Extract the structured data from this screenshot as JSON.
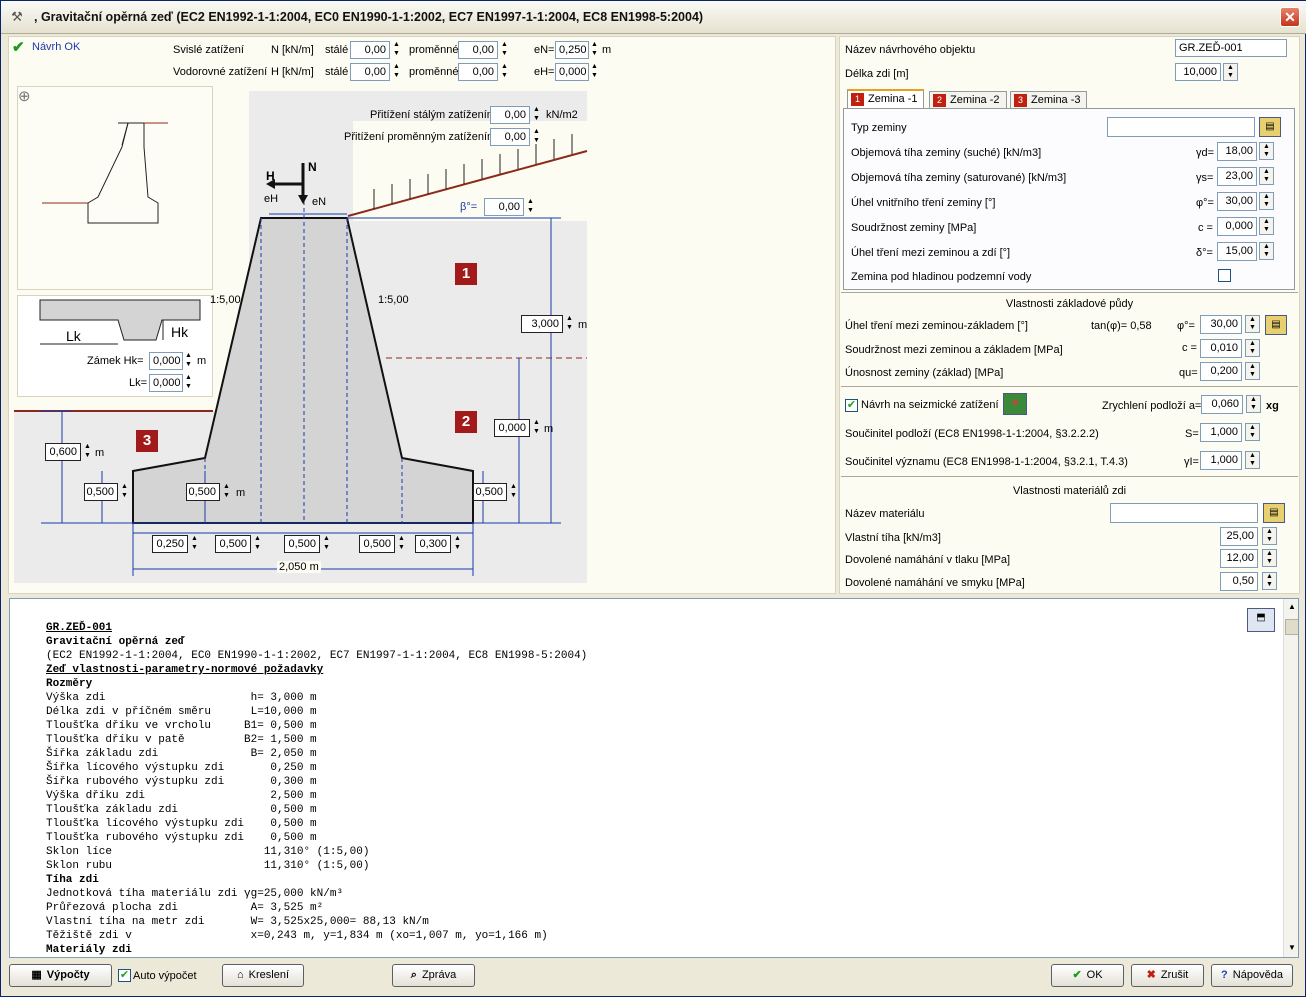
{
  "window": {
    "title": ", Gravitační opěrná zeď (EC2 EN1992-1-1:2004, EC0 EN1990-1-1:2002, EC7 EN1997-1-1:2004, EC8 EN1998-5:2004)",
    "close_label": "✕"
  },
  "status": {
    "label": "Návrh OK"
  },
  "loads": {
    "vertical_label": "Svislé zatížení",
    "vertical_unit": "N [kN/m]",
    "horizontal_label": "Vodorovné zatížení",
    "horizontal_unit": "H [kN/m]",
    "permanent_label": "stálé",
    "variable_label": "proměnné",
    "N_perm": "0,00",
    "N_var": "0,00",
    "eN_label": "eN=",
    "eN": "0,250",
    "eN_unit": "m",
    "H_perm": "0,00",
    "H_var": "0,00",
    "eH_label": "eH=",
    "eH": "0,000"
  },
  "surcharge": {
    "perm_label": "Přitížení stálým zatížením",
    "perm": "0,00",
    "perm_unit": "kN/m2",
    "var_label": "Přitížení proměnným zatížením",
    "var": "0,00"
  },
  "drawing": {
    "beta_label": "β°=",
    "beta": "0,00",
    "H": "H",
    "N": "N",
    "eH_mark": "eH",
    "eN_mark": "eN",
    "slope_left": "1:5,00",
    "slope_right": "1:5,00",
    "height": "3,000",
    "height_unit": "m",
    "water": "0,000",
    "water_unit": "m",
    "front_soil": "0,600",
    "front_soil_unit": "m",
    "toe_thk": "0,500",
    "base_thk": "0,500",
    "base_thk_unit": "m",
    "heel_thk": "0,500",
    "b1": "0,250",
    "b2": "0,500",
    "b3": "0,500",
    "b4": "0,500",
    "b5": "0,300",
    "total_width": "2,050",
    "total_unit": "m",
    "marker1": "1",
    "marker2": "2",
    "marker3": "3"
  },
  "key": {
    "lk_label": "Lk",
    "hk_label": "Hk",
    "zamek_label": "Zámek Hk=",
    "hk": "0,000",
    "hk_unit": "m",
    "lk_field_label": "Lk=",
    "lk": "0,000"
  },
  "object": {
    "name_label": "Název návrhového objektu",
    "name": "GR.ZEĎ-001",
    "length_label": "Délka zdi [m]",
    "length": "10,000"
  },
  "tabs": [
    {
      "num": "1",
      "label": "Zemina -1"
    },
    {
      "num": "2",
      "label": "Zemina -2"
    },
    {
      "num": "3",
      "label": "Zemina -3"
    }
  ],
  "soil": {
    "type_label": "Typ zeminy",
    "type": "",
    "rows": [
      {
        "label": "Objemová tíha zeminy (suché) [kN/m3]",
        "sym": "γd=",
        "value": "18,00"
      },
      {
        "label": "Objemová tíha zeminy (saturované) [kN/m3]",
        "sym": "γs=",
        "value": "23,00"
      },
      {
        "label": "Úhel vnitřního tření zeminy [°]",
        "sym": "φ°=",
        "value": "30,00"
      },
      {
        "label": "Soudržnost zeminy [MPa]",
        "sym": "c =",
        "value": "0,000"
      },
      {
        "label": "Úhel tření mezi zeminou a zdí [°]",
        "sym": "δ°=",
        "value": "15,00"
      }
    ],
    "water_label": "Zemina pod hladinou podzemní vody"
  },
  "foundation": {
    "title": "Vlastnosti základové půdy",
    "friction_label": "Úhel tření mezi zeminou-základem [°]",
    "tan_label": "tan(φ)= 0,58",
    "phi_sym": "φ°=",
    "phi": "30,00",
    "cohesion_label": "Soudržnost mezi zeminou a základem [MPa]",
    "c_sym": "c =",
    "c": "0,010",
    "bearing_label": "Únosnost zeminy (základ) [MPa]",
    "qu_sym": "qu=",
    "qu": "0,200"
  },
  "seismic": {
    "check_label": "Návrh na seizmické zatížení",
    "accel_label": "Zrychlení podloží a=",
    "accel": "0,060",
    "accel_unit": "xg",
    "soil_label": "Součinitel podloží (EC8 EN1998-1-1:2004, §3.2.2.2)",
    "S_sym": "S=",
    "S": "1,000",
    "importance_label": "Součinitel významu (EC8 EN1998-1-1:2004, §3.2.1, T.4.3)",
    "gi_sym": "γI=",
    "gi": "1,000"
  },
  "material": {
    "title": "Vlastnosti materiálů zdi",
    "name_label": "Název materiálu",
    "name": "",
    "weight_label": "Vlastní tíha [kN/m3]",
    "weight": "25,00",
    "compression_label": "Dovolené namáhání v tlaku  [MPa]",
    "compression": "12,00",
    "shear_label": "Dovolené namáhání ve smyku  [MPa]",
    "shear": "0,50"
  },
  "report": {
    "l0": "GR.ZEĎ-001",
    "l1": "Gravitační opěrná zeď",
    "l2": "(EC2 EN1992-1-1:2004, EC0 EN1990-1-1:2002, EC7 EN1997-1-1:2004, EC8 EN1998-5:2004)",
    "l3": "Zeď vlastnosti-parametry-normové požadavky",
    "l4": "Rozměry",
    "l5": "Výška zdi                      h= 3,000 m",
    "l6": "Délka zdi v příčném směru      L=10,000 m",
    "l7": "Tloušťka dříku ve vrcholu     B1= 0,500 m",
    "l8": "Tloušťka dříku v patě         B2= 1,500 m",
    "l9": "Šířka základu zdi              B= 2,050 m",
    "l10": "Šířka lícového výstupku zdi       0,250 m",
    "l11": "Šířka rubového výstupku zdi       0,300 m",
    "l12": "Výška dříku zdi                   2,500 m",
    "l13": "Tloušťka základu zdi              0,500 m",
    "l14": "Tloušťka lícového výstupku zdi    0,500 m",
    "l15": "Tloušťka rubového výstupku zdi    0,500 m",
    "l16": "Sklon líce                       11,310° (1:5,00)",
    "l17": "Sklon rubu                       11,310° (1:5,00)",
    "l18": "Tíha zdi",
    "l19": "Jednotková tíha materiálu zdi γg=25,000 kN/m³",
    "l20": "Průřezová plocha zdi           A= 3,525 m²",
    "l21": "Vlastní tíha na metr zdi       W= 3,525x25,000= 88,13 kN/m",
    "l22": "Těžiště zdi v                  x=0,243 m, y=1,834 m (xo=1,007 m, yo=1,166 m)",
    "l23": "Materiály zdi"
  },
  "buttons": {
    "calc": "Výpočty",
    "auto": "Auto výpočet",
    "draw": "Kreslení",
    "report": "Zpráva",
    "ok": "OK",
    "cancel": "Zrušit",
    "help": "Nápověda"
  }
}
